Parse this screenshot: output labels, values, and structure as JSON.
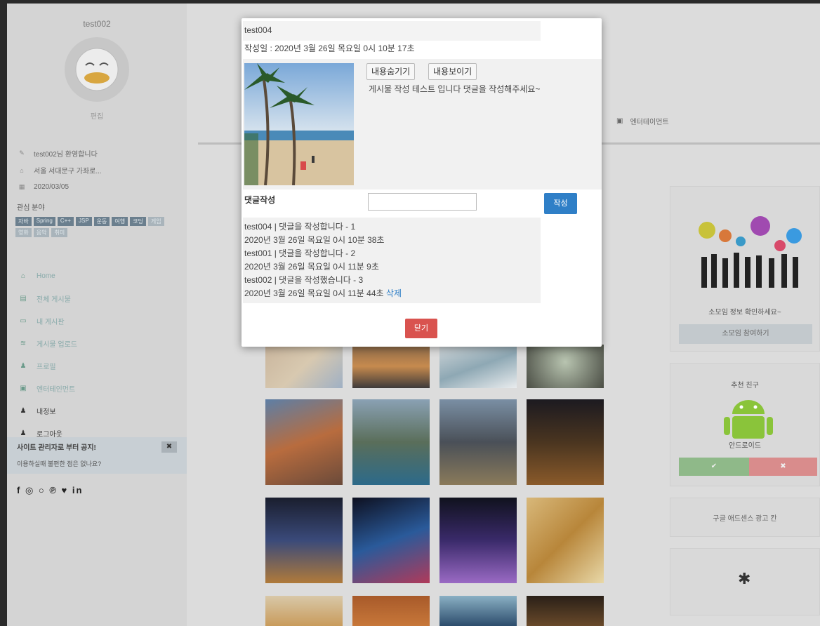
{
  "sidebar": {
    "username": "test002",
    "edit_label": "편집",
    "info": [
      {
        "icon": "pencil-icon",
        "text": "test002님 환영합니다"
      },
      {
        "icon": "home-icon",
        "text": "서울 서대문구 가좌로..."
      },
      {
        "icon": "calendar-icon",
        "text": "2020/03/05"
      }
    ],
    "interest_label": "관심 분야",
    "tags": [
      "자바",
      "Spring",
      "C++",
      "JSP",
      "운동",
      "여행",
      "코딩",
      "게임",
      "영화",
      "음악",
      "취미"
    ],
    "nav": [
      {
        "icon": "home-icon",
        "label": "Home"
      },
      {
        "icon": "list-icon",
        "label": "전체 게시물"
      },
      {
        "icon": "folder-icon",
        "label": "내 게시판"
      },
      {
        "icon": "wifi-icon",
        "label": "게시물 업로드"
      },
      {
        "icon": "user-icon",
        "label": "프로필"
      },
      {
        "icon": "film-icon",
        "label": "엔터테인먼트"
      },
      {
        "icon": "user-icon",
        "label": "내정보"
      },
      {
        "icon": "user-icon",
        "label": "로그아웃"
      }
    ],
    "notice": {
      "title": "사이트 관리자로 부터 공지!",
      "text": "이용하실때 불편한 점은 없나요?",
      "close": "✖"
    },
    "social": "f ◎ ○ ℗ ♥ in"
  },
  "header": {
    "entertainment": "엔터테이먼트"
  },
  "widgets": {
    "group": {
      "label": "소모임 정보 확인하세요~",
      "button": "소모임 참여하기"
    },
    "friend": {
      "title": "추천 친구",
      "name": "안드로이드",
      "accept": "✔",
      "reject": "✖"
    },
    "ad": {
      "label": "구글 애드센스 광고 칸"
    }
  },
  "modal": {
    "author": "test004",
    "date": "작성일 : 2020년 3월 26일 목요일 0시 10분 17초",
    "hide_button": "내용숨기기",
    "show_button": "내용보이기",
    "content": "게시물 작성 테스트 입니다 댓글을 작성해주세요~",
    "comment_label": "댓글작성",
    "comment_placeholder": "",
    "submit_button": "작성",
    "comments": [
      {
        "text": "test004 | 댓글을 작성합니다 - 1",
        "date": "2020년 3월 26일 목요일 0시 10분 38초"
      },
      {
        "text": "test001 | 댓글을 작성합니다 - 2",
        "date": "2020년 3월 26일 목요일 0시 11분 9초"
      },
      {
        "text": "test002 | 댓글을 작성했습니다 - 3",
        "date": "2020년 3월 26일 목요일 0시 11분 44초",
        "delete": "삭제"
      }
    ],
    "close_button": "닫기"
  },
  "colors": {
    "primary": "#2f7fc7",
    "danger": "#d9534f",
    "accept": "#8fb989",
    "reject": "#d98c8c"
  }
}
